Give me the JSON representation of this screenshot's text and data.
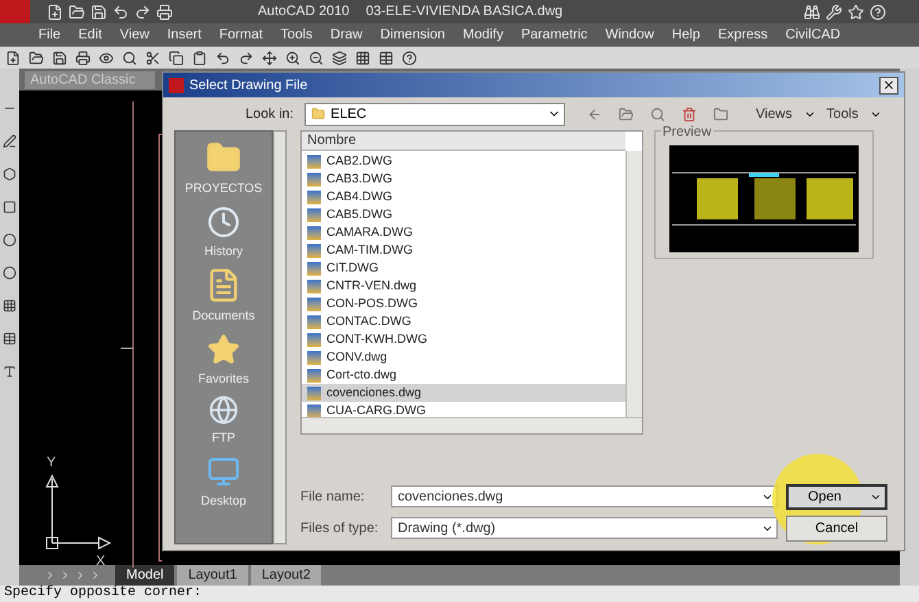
{
  "app_title": "AutoCAD 2010",
  "document_title": "03-ELE-VIVIENDA BASICA.dwg",
  "menu": [
    "File",
    "Edit",
    "View",
    "Insert",
    "Format",
    "Tools",
    "Draw",
    "Dimension",
    "Modify",
    "Parametric",
    "Window",
    "Help",
    "Express",
    "CivilCAD"
  ],
  "workspace": "AutoCAD Classic",
  "dialog": {
    "title": "Select Drawing File",
    "look_in_label": "Look in:",
    "look_in_value": "ELEC",
    "views": "Views",
    "tools": "Tools",
    "places": [
      {
        "label": "PROYECTOS",
        "kind": "folder"
      },
      {
        "label": "History",
        "kind": "history"
      },
      {
        "label": "Documents",
        "kind": "documents"
      },
      {
        "label": "Favorites",
        "kind": "favorites"
      },
      {
        "label": "FTP",
        "kind": "ftp"
      },
      {
        "label": "Desktop",
        "kind": "desktop"
      }
    ],
    "column": "Nombre",
    "files": [
      {
        "name": "CAB2.DWG",
        "selected": false
      },
      {
        "name": "CAB3.DWG",
        "selected": false
      },
      {
        "name": "CAB4.DWG",
        "selected": false
      },
      {
        "name": "CAB5.DWG",
        "selected": false
      },
      {
        "name": "CAMARA.DWG",
        "selected": false
      },
      {
        "name": "CAM-TIM.DWG",
        "selected": false
      },
      {
        "name": "CIT.DWG",
        "selected": false
      },
      {
        "name": "CNTR-VEN.dwg",
        "selected": false
      },
      {
        "name": "CON-POS.DWG",
        "selected": false
      },
      {
        "name": "CONTAC.DWG",
        "selected": false
      },
      {
        "name": "CONT-KWH.DWG",
        "selected": false
      },
      {
        "name": "CONV.dwg",
        "selected": false
      },
      {
        "name": "Cort-cto.dwg",
        "selected": false
      },
      {
        "name": "covenciones.dwg",
        "selected": true
      },
      {
        "name": "CUA-CARG.DWG",
        "selected": false
      }
    ],
    "preview_label": "Preview",
    "file_name_label": "File name:",
    "file_name_value": "covenciones.dwg",
    "file_type_label": "Files of type:",
    "file_type_value": "Drawing (*.dwg)",
    "open": "Open",
    "cancel": "Cancel"
  },
  "layout_tabs": [
    {
      "label": "Model",
      "selected": true
    },
    {
      "label": "Layout1",
      "selected": false
    },
    {
      "label": "Layout2",
      "selected": false
    }
  ],
  "axis": {
    "x": "X",
    "y": "Y"
  },
  "command_line": "Specify opposite corner:"
}
